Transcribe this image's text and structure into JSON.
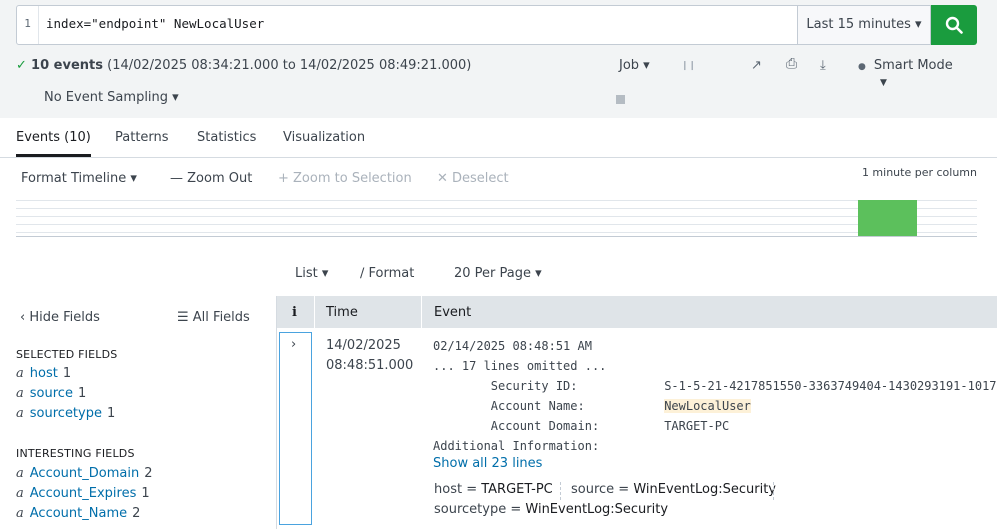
{
  "search": {
    "line_number": "1",
    "query": "index=\"endpoint\" NewLocalUser",
    "time_range": "Last 15 minutes ▾"
  },
  "status": {
    "check": "✓",
    "count": "10 events",
    "range": "(14/02/2025 08:34:21.000 to 14/02/2025 08:49:21.000)",
    "sampling": "No Event Sampling ▾",
    "job": "Job ▾",
    "mode": "Smart Mode",
    "mode_caret": "▼"
  },
  "icons": {
    "pause": "❙❙",
    "share": "↗",
    "print": "⎙",
    "export": "⤓",
    "mode_bulb": "●"
  },
  "tabs": [
    "Events (10)",
    "Patterns",
    "Statistics",
    "Visualization"
  ],
  "timeline": {
    "format": "Format Timeline ▾",
    "zoom_out": "— Zoom Out",
    "zoom_selection": "+ Zoom to Selection",
    "deselect": "✕ Deselect",
    "per_column": "1 minute per column",
    "bar_level": 1.0,
    "accent": "#5cc05c"
  },
  "list_tools": {
    "list": "List ▾",
    "format": "∕ Format",
    "per_page": "20 Per Page ▾"
  },
  "sidebar": {
    "hide": "‹ Hide Fields",
    "all": "☰ All Fields",
    "selected_title": "SELECTED FIELDS",
    "selected": [
      {
        "type": "a",
        "name": "host",
        "count": "1"
      },
      {
        "type": "a",
        "name": "source",
        "count": "1"
      },
      {
        "type": "a",
        "name": "sourcetype",
        "count": "1"
      }
    ],
    "interesting_title": "INTERESTING FIELDS",
    "interesting": [
      {
        "type": "a",
        "name": "Account_Domain",
        "count": "2"
      },
      {
        "type": "a",
        "name": "Account_Expires",
        "count": "1"
      },
      {
        "type": "a",
        "name": "Account_Name",
        "count": "2"
      }
    ]
  },
  "table": {
    "col_info": "i",
    "col_time": "Time",
    "col_event": "Event",
    "expander": "›",
    "event": {
      "date": "14/02/2025",
      "time": "08:48:51.000",
      "lines": [
        "02/14/2025 08:48:51 AM",
        "... 17 lines omitted ...",
        "        Security ID:            S-1-5-21-4217851550-3363749404-1430293191-1017",
        "        Account Name:           ",
        "        Account Domain:         TARGET-PC",
        "Additional Information:"
      ],
      "account_name": "NewLocalUser",
      "show_all": "Show all 23 lines",
      "host_key": "host =",
      "host_val": "TARGET-PC",
      "source_key": "source =",
      "source_val": "WinEventLog:Security",
      "sourcetype_key": "sourcetype =",
      "sourcetype_val": "WinEventLog:Security"
    }
  }
}
